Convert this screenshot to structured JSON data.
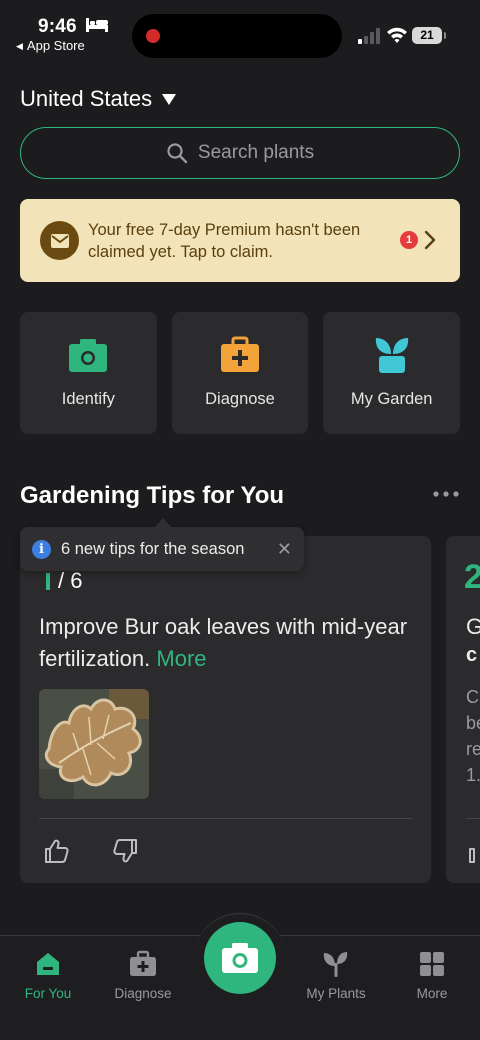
{
  "status_bar": {
    "time": "9:46",
    "back_app": "App Store",
    "battery": "21"
  },
  "region": {
    "label": "United States"
  },
  "search": {
    "placeholder": "Search plants"
  },
  "premium_banner": {
    "text": "Your free 7-day Premium hasn't been claimed yet. Tap to claim.",
    "badge_count": "1"
  },
  "quick_actions": [
    {
      "label": "Identify",
      "icon": "camera-icon",
      "color": "#2fb67f"
    },
    {
      "label": "Diagnose",
      "icon": "first-aid-kit-icon",
      "color": "#f2a33a"
    },
    {
      "label": "My Garden",
      "icon": "potted-plant-icon",
      "color": "#3fc7d6"
    }
  ],
  "tips": {
    "title": "Gardening Tips for You",
    "tooltip": "6 new tips for the season",
    "card": {
      "counter": "/ 6",
      "text": "Improve Bur oak leaves with mid-year fertilization.",
      "more": "More"
    },
    "next_card": {
      "number": "2",
      "line1": "G",
      "line2": "c",
      "lines": [
        "C",
        "be",
        "re",
        "1."
      ]
    }
  },
  "tabbar": {
    "items": [
      {
        "label": "For You",
        "active": true
      },
      {
        "label": "Diagnose",
        "active": false
      },
      {
        "label": "My Plants",
        "active": false
      },
      {
        "label": "More",
        "active": false
      }
    ]
  },
  "colors": {
    "accent": "#2fb67f",
    "background": "#1c1c1e",
    "card": "#2b2b2d",
    "banner": "#f2e4b8"
  }
}
